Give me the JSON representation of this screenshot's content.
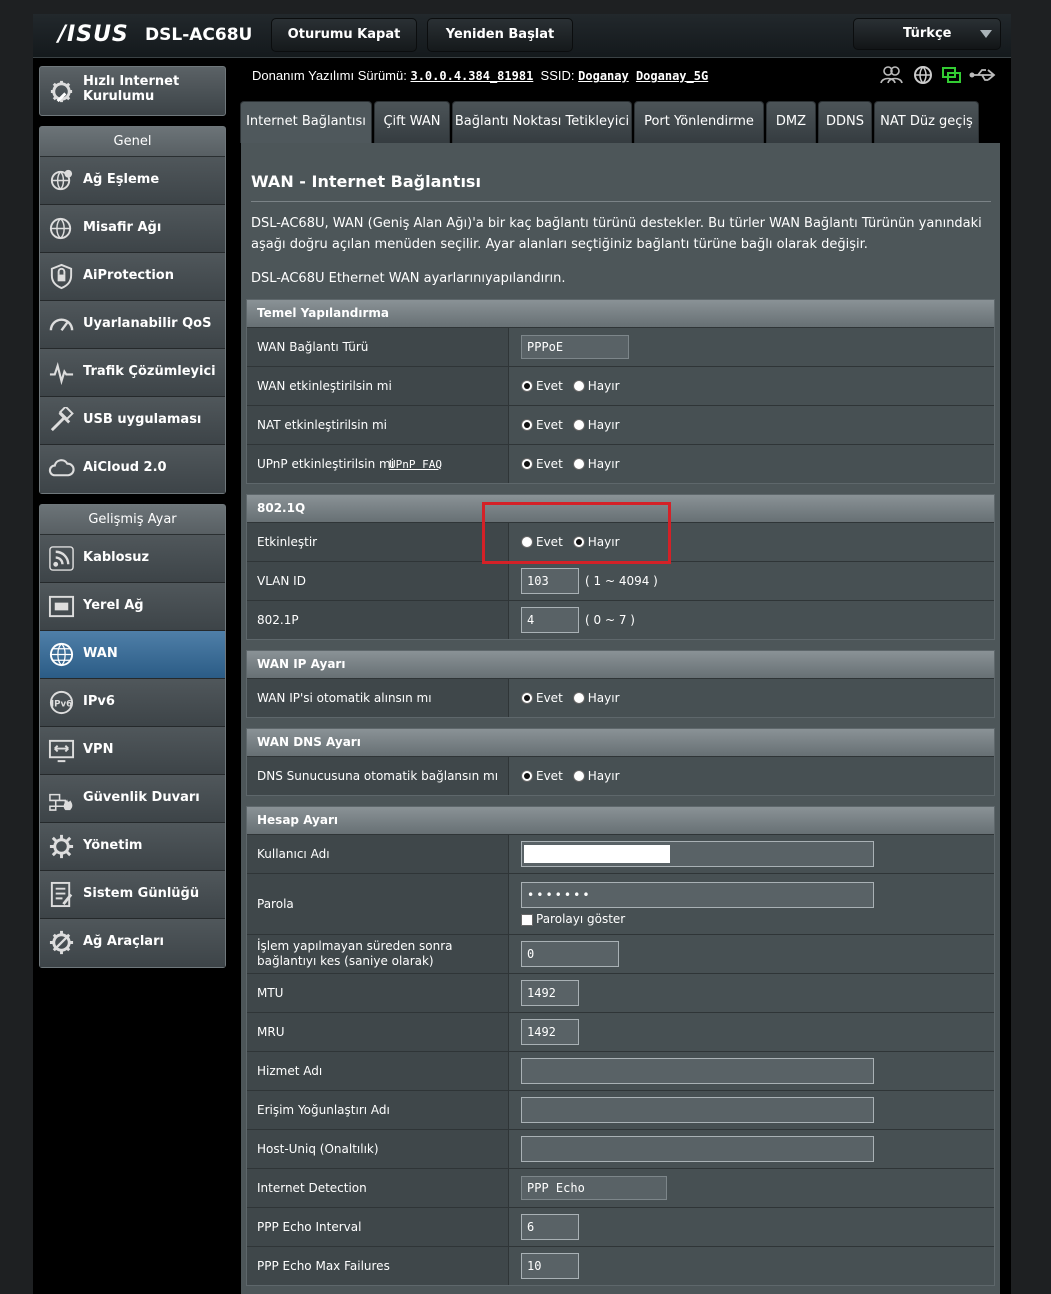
{
  "header": {
    "logo": "/ISUS",
    "model": "DSL-AC68U",
    "logout_label": "Oturumu Kapat",
    "reboot_label": "Yeniden Başlat",
    "language": "Türkçe"
  },
  "sidebar": {
    "quick_setup_label": "Hızlı Internet Kurulumu",
    "general_title": "Genel",
    "general_items": [
      {
        "label": "Ağ Eşleme",
        "icon": "network-map-icon"
      },
      {
        "label": "Misafir Ağı",
        "icon": "guest-network-icon"
      },
      {
        "label": "AiProtection",
        "icon": "shield-lock-icon"
      },
      {
        "label": "Uyarlanabilir QoS",
        "icon": "speedometer-icon"
      },
      {
        "label": "Trafik Çözümleyici",
        "icon": "traffic-analyzer-icon"
      },
      {
        "label": "USB uygulaması",
        "icon": "usb-app-icon"
      },
      {
        "label": "AiCloud 2.0",
        "icon": "cloud-icon"
      }
    ],
    "advanced_title": "Gelişmiş Ayar",
    "advanced_items": [
      {
        "label": "Kablosuz",
        "icon": "wireless-icon"
      },
      {
        "label": "Yerel Ağ",
        "icon": "lan-icon"
      },
      {
        "label": "WAN",
        "icon": "globe-icon"
      },
      {
        "label": "IPv6",
        "icon": "ipv6-globe-icon"
      },
      {
        "label": "VPN",
        "icon": "vpn-icon"
      },
      {
        "label": "Güvenlik Duvarı",
        "icon": "firewall-icon"
      },
      {
        "label": "Yönetim",
        "icon": "admin-gear-icon"
      },
      {
        "label": "Sistem Günlüğü",
        "icon": "system-log-icon"
      },
      {
        "label": "Ağ Araçları",
        "icon": "network-tools-icon"
      }
    ],
    "active_item": "WAN"
  },
  "info": {
    "firmware_label": "Donanım Yazılımı Sürümü:",
    "firmware_version": "3.0.0.4.384_81981",
    "ssid_label": "SSID:",
    "ssid_1": "Doganay",
    "ssid_2": "Doganay_5G"
  },
  "tabs": [
    "Internet Bağlantısı",
    "Çift WAN",
    "Bağlantı Noktası Tetikleyici",
    "Port Yönlendirme",
    "DMZ",
    "DDNS",
    "NAT Düz geçiş"
  ],
  "active_tab": "Internet Bağlantısı",
  "page": {
    "title": "WAN - Internet Bağlantısı",
    "description": "DSL-AC68U, WAN (Geniş Alan Ağı)'a bir kaç bağlantı türünü destekler. Bu türler WAN Bağlantı Türünün yanındaki aşağı doğru açılan menüden seçilir. Ayar alanları seçtiğiniz bağlantı türüne bağlı olarak değişir.",
    "description2": "DSL-AC68U Ethernet WAN ayarlarınıyapılandırın."
  },
  "radio_labels": {
    "yes": "Evet",
    "no": "Hayır"
  },
  "basic": {
    "title": "Temel Yapılandırma",
    "wan_type_label": "WAN Bağlantı Türü",
    "wan_type_value": "PPPoE",
    "enable_wan_label": "WAN etkinleştirilsin mi",
    "enable_wan": "yes",
    "enable_nat_label": "NAT etkinleştirilsin mi",
    "enable_nat": "yes",
    "enable_upnp_label": "UPnP etkinleştirilsin mi",
    "upnp_faq": "UPnP FAQ",
    "enable_upnp": "yes"
  },
  "dot1q": {
    "title": "802.1Q",
    "enable_label": "Etkinleştir",
    "enable": "no",
    "vlan_label": "VLAN ID",
    "vlan_value": "103",
    "vlan_range": "( 1 ~ 4094 )",
    "prio_label": "802.1P",
    "prio_value": "4",
    "prio_range": "( 0 ~ 7 )"
  },
  "wanip": {
    "title": "WAN IP Ayarı",
    "auto_ip_label": "WAN IP'si otomatik alınsın mı",
    "auto_ip": "yes"
  },
  "wandns": {
    "title": "WAN DNS Ayarı",
    "auto_dns_label": "DNS Sunucusuna otomatik bağlansın mı",
    "auto_dns": "yes"
  },
  "account": {
    "title": "Hesap Ayarı",
    "username_label": "Kullanıcı Adı",
    "username_value": "",
    "password_label": "Parola",
    "password_value": "•••••••",
    "show_password_label": "Parolayı göster",
    "idle_label": "İşlem yapılmayan süreden sonra bağlantıyı kes (saniye olarak)",
    "idle_value": "0",
    "mtu_label": "MTU",
    "mtu_value": "1492",
    "mru_label": "MRU",
    "mru_value": "1492",
    "service_label": "Hizmet Adı",
    "service_value": "",
    "ac_label": "Erişim Yoğunlaştırı Adı",
    "ac_value": "",
    "hostuniq_label": "Host-Uniq (Onaltılık)",
    "hostuniq_value": "",
    "detect_label": "Internet Detection",
    "detect_value": "PPP Echo",
    "echo_interval_label": "PPP Echo Interval",
    "echo_interval_value": "6",
    "echo_fail_label": "PPP Echo Max Failures",
    "echo_fail_value": "10"
  },
  "colors": {
    "highlight": "#d42127",
    "active_nav": "#3b6a94"
  }
}
